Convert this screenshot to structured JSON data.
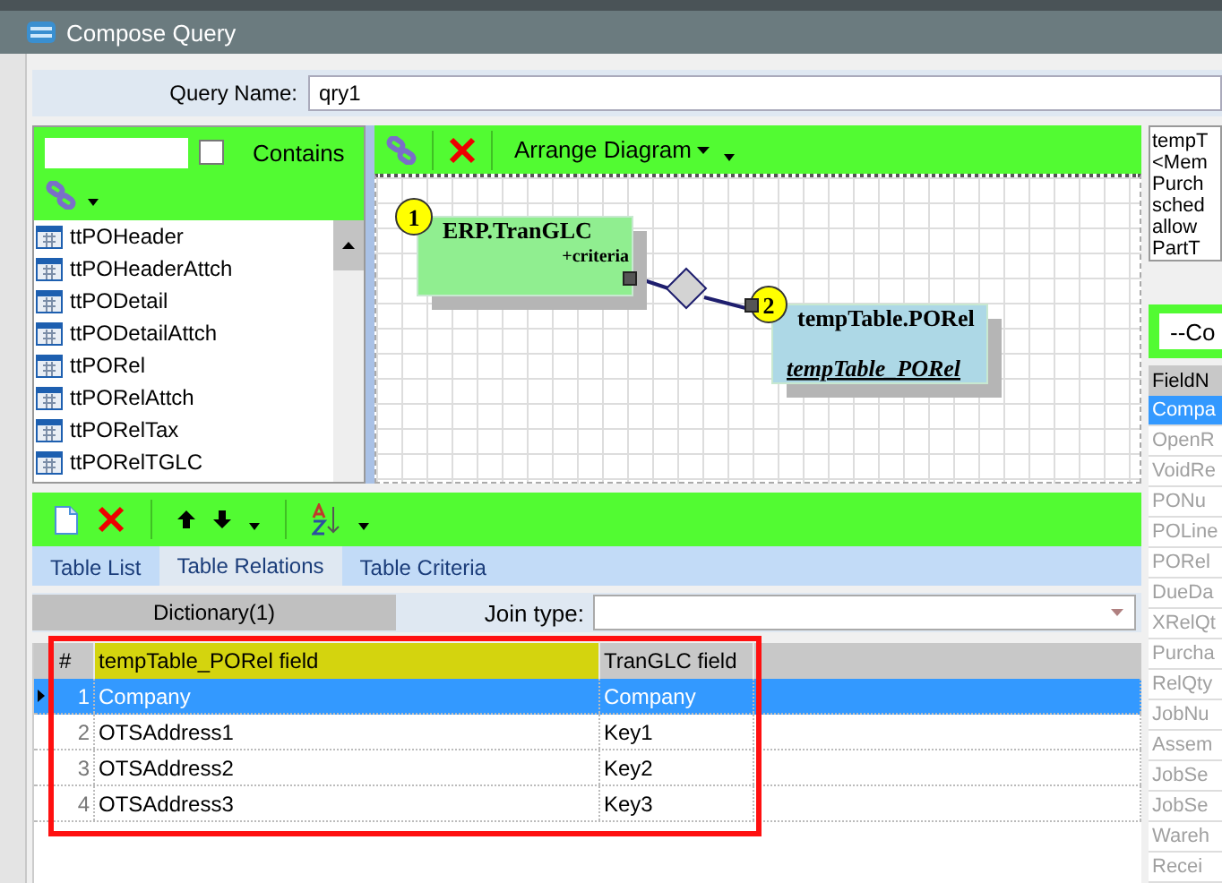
{
  "window": {
    "title": "Compose Query"
  },
  "query_name": {
    "label": "Query Name:",
    "value": "qry1"
  },
  "table_search": {
    "contains": {
      "label": "Contains",
      "checked": false
    }
  },
  "table_list": [
    "ttPOHeader",
    "ttPOHeaderAttch",
    "ttPODetail",
    "ttPODetailAttch",
    "ttPORel",
    "ttPORelAttch",
    "ttPORelTax",
    "ttPORelTGLC"
  ],
  "diagram": {
    "arrange_label": "Arrange Diagram",
    "nodes": [
      {
        "number": "1",
        "title": "ERP.TranGLC",
        "subtitle": "+criteria",
        "kind": "source"
      },
      {
        "number": "2",
        "title": "tempTable.PORel",
        "subtitle": "tempTable_PORel",
        "kind": "target"
      }
    ]
  },
  "tabs": [
    {
      "label": "Table List",
      "selected": false
    },
    {
      "label": "Table Relations",
      "selected": true
    },
    {
      "label": "Table Criteria",
      "selected": false
    }
  ],
  "relations": {
    "dictionary": "Dictionary(1)",
    "join_type_label": "Join type:",
    "columns": [
      {
        "label": "#",
        "highlighted": false
      },
      {
        "label": "tempTable_PORel field",
        "highlighted": true
      },
      {
        "label": "TranGLC field",
        "highlighted": false
      }
    ],
    "rows": [
      {
        "number": "1",
        "field": "Company",
        "tran_field": "Company",
        "selected": true
      },
      {
        "number": "2",
        "field": "OTSAddress1",
        "tran_field": "Key1",
        "selected": false
      },
      {
        "number": "3",
        "field": "OTSAddress2",
        "tran_field": "Key2",
        "selected": false
      },
      {
        "number": "4",
        "field": "OTSAddress3",
        "tran_field": "Key3",
        "selected": false
      }
    ]
  },
  "description": [
    "tempT",
    "<Mem",
    "Purch",
    "sched",
    "allow",
    "PartT"
  ],
  "field_filter": {
    "value": "--Co"
  },
  "field_list": {
    "header": "FieldN",
    "items": [
      {
        "label": "Compa",
        "selected": true,
        "disabled": false
      },
      {
        "label": "OpenR",
        "selected": false,
        "disabled": true
      },
      {
        "label": "VoidRe",
        "selected": false,
        "disabled": true
      },
      {
        "label": "PONu",
        "selected": false,
        "disabled": true
      },
      {
        "label": "POLine",
        "selected": false,
        "disabled": true
      },
      {
        "label": "PORel",
        "selected": false,
        "disabled": true
      },
      {
        "label": "DueDa",
        "selected": false,
        "disabled": true
      },
      {
        "label": "XRelQt",
        "selected": false,
        "disabled": true
      },
      {
        "label": "Purcha",
        "selected": false,
        "disabled": true
      },
      {
        "label": "RelQty",
        "selected": false,
        "disabled": true
      },
      {
        "label": "JobNu",
        "selected": false,
        "disabled": true
      },
      {
        "label": "Assem",
        "selected": false,
        "disabled": true
      },
      {
        "label": "JobSe",
        "selected": false,
        "disabled": true
      },
      {
        "label": "JobSe",
        "selected": false,
        "disabled": true
      },
      {
        "label": "Wareh",
        "selected": false,
        "disabled": true
      },
      {
        "label": "Recei",
        "selected": false,
        "disabled": true
      }
    ]
  }
}
